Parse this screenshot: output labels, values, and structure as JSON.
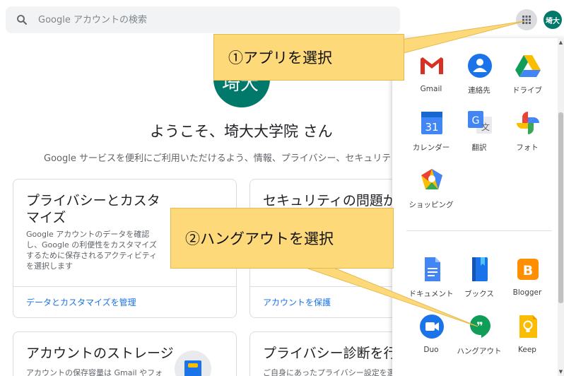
{
  "search": {
    "placeholder": "Google アカウントの検索"
  },
  "header": {
    "avatar_initials": "埼大"
  },
  "hero": {
    "avatar_text": "埼大",
    "welcome": "ようこそ、埼大大学院 さん",
    "intro": "Google サービスを便利にご利用いただけるよう、情報、プライバシー、セキュリティを"
  },
  "cards": [
    {
      "title": "プライバシーとカスタマイズ",
      "desc": "Google アカウントのデータを確認し、Google の利便性をカスタマイズするために保存されるアクティビティを選択します",
      "link": "データとカスタマイズを管理"
    },
    {
      "title": "セキュリティの問題が見",
      "desc": "",
      "link": "アカウントを保護"
    },
    {
      "title": "アカウントのストレージ",
      "desc": "アカウントの保存容量は Gmail やフォ"
    },
    {
      "title": "プライバシー診断を行う",
      "desc": "ご自身にあったプライバシー設定を選"
    }
  ],
  "apps_panel": {
    "apps": [
      {
        "label": "Gmail",
        "icon": "gmail-icon"
      },
      {
        "label": "連絡先",
        "icon": "contacts-icon"
      },
      {
        "label": "ドライブ",
        "icon": "drive-icon"
      },
      {
        "label": "カレンダー",
        "icon": "calendar-icon",
        "calendar_day": "31"
      },
      {
        "label": "翻訳",
        "icon": "translate-icon",
        "glyph_g": "G",
        "glyph_ja": "文"
      },
      {
        "label": "フォト",
        "icon": "photos-icon"
      },
      {
        "label": "ショッピング",
        "icon": "shopping-icon"
      },
      {
        "label": "ドキュメント",
        "icon": "docs-icon"
      },
      {
        "label": "ブックス",
        "icon": "books-icon"
      },
      {
        "label": "Blogger",
        "icon": "blogger-icon",
        "glyph": "B"
      },
      {
        "label": "Duo",
        "icon": "duo-icon"
      },
      {
        "label": "ハングアウト",
        "icon": "hangouts-icon",
        "glyph": "❞"
      },
      {
        "label": "Keep",
        "icon": "keep-icon"
      }
    ]
  },
  "annotations": {
    "step1": "①アプリを選択",
    "step2": "②ハングアウトを選択"
  },
  "colors": {
    "avatar": "#00796b",
    "callout_fill": "#fdd97a",
    "link": "#1a73e8"
  }
}
